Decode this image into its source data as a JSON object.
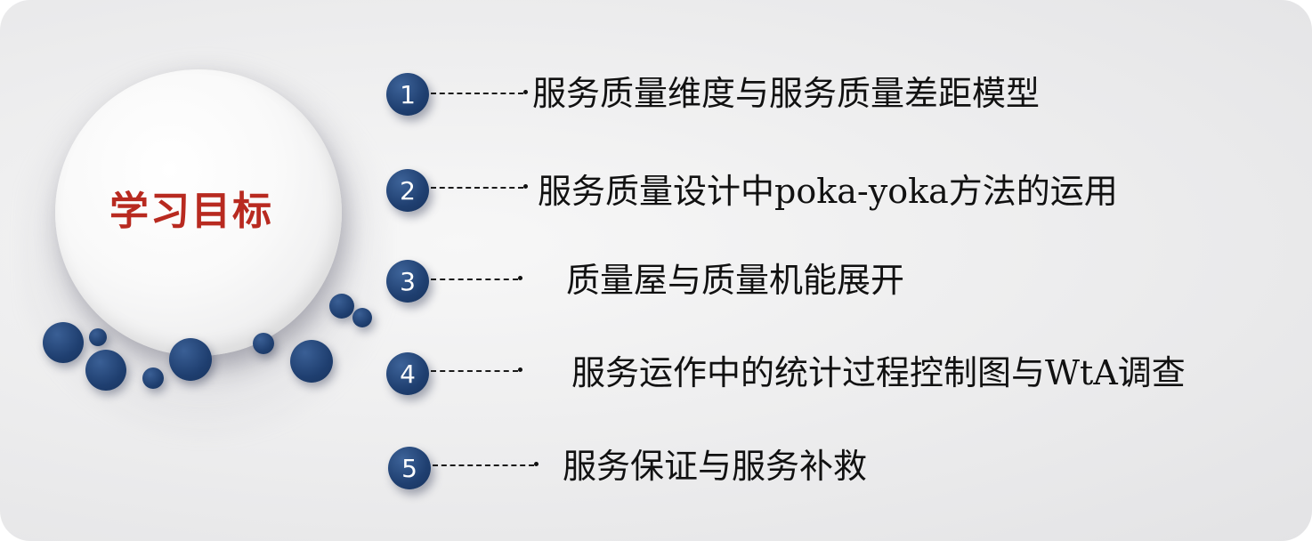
{
  "title": "学习目标",
  "items": [
    {
      "number": "1",
      "text": "服务质量维度与服务质量差距模型"
    },
    {
      "number": "2",
      "text": "服务质量设计中poka-yoka方法的运用"
    },
    {
      "number": "3",
      "text": "质量屋与质量机能展开"
    },
    {
      "number": "4",
      "text": "服务运作中的统计过程控制图与WtA调查"
    },
    {
      "number": "5",
      "text": "服务保证与服务补救"
    }
  ],
  "colors": {
    "title": "#b82a20",
    "accent_dot": "#1f3f70",
    "background": "#ececed"
  }
}
